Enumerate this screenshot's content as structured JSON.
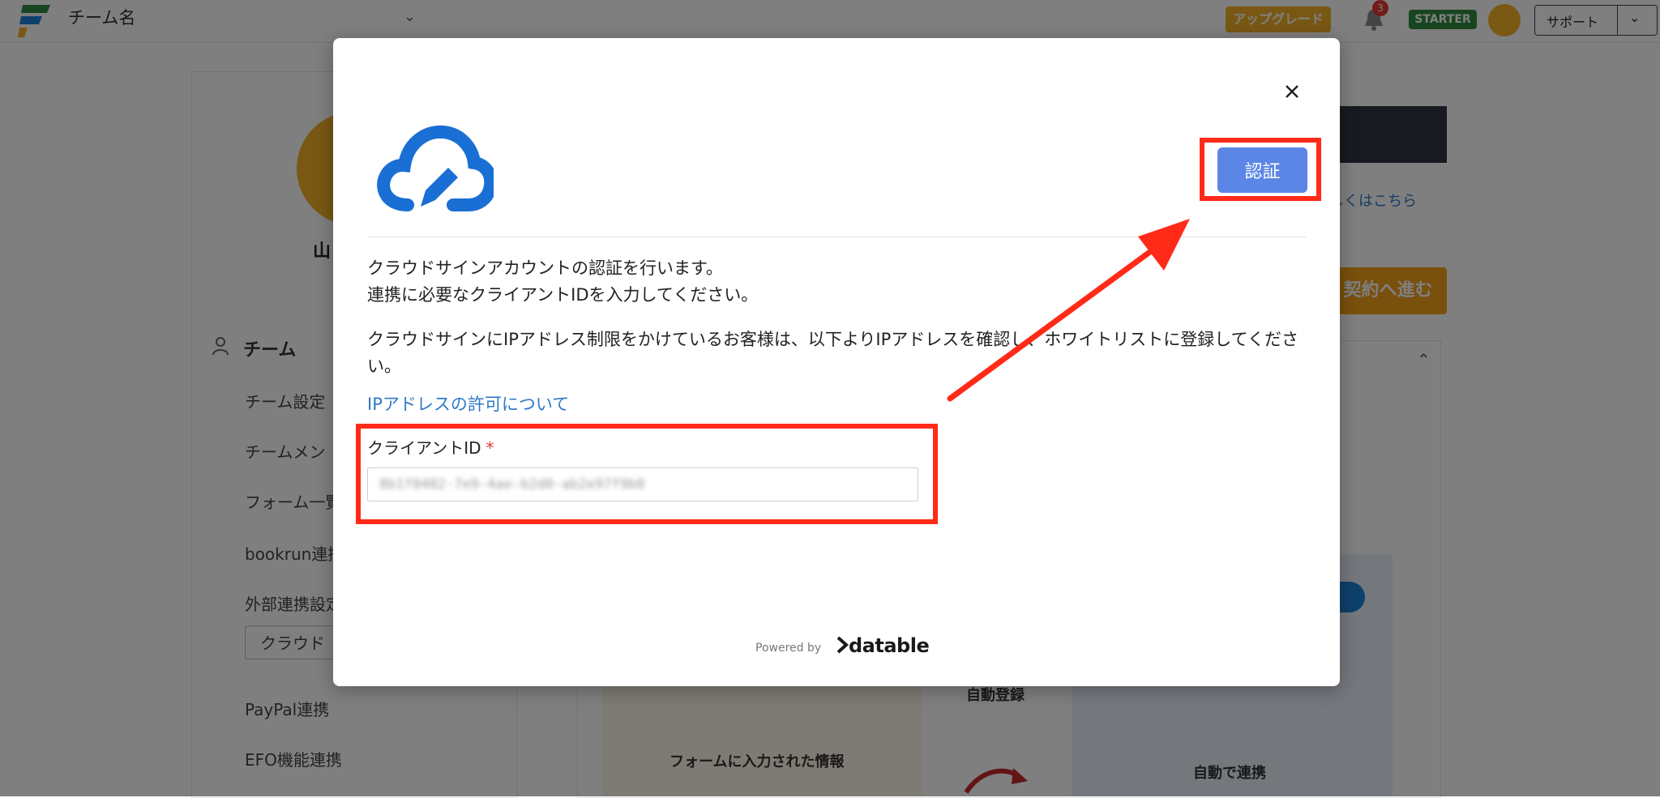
{
  "topbar": {
    "team_name": "チーム名",
    "upgrade_label": "アップグレード",
    "notification_count": "3",
    "plan_badge": "STARTER",
    "support_label": "サポート"
  },
  "sidebar": {
    "user_name": "山",
    "section_title": "チーム",
    "items": [
      {
        "label": "チーム設定"
      },
      {
        "label": "チームメン"
      },
      {
        "label": "フォーム一覧"
      },
      {
        "label": "bookrun連携"
      },
      {
        "label": "外部連携設定"
      },
      {
        "label": "PayPal連携"
      },
      {
        "label": "EFO機能連携"
      }
    ],
    "select_value": "クラウド"
  },
  "main": {
    "detail_link": "しくはこちら",
    "contract_button": "契約へ進む",
    "illus_left_label": "フォームに入力された情報",
    "illus_mid_label": "自動登録",
    "illus_right_label": "自動で連携"
  },
  "modal": {
    "close_label": "×",
    "auth_button": "認証",
    "intro_line1": "クラウドサインアカウントの認証を行います。",
    "intro_line2": "連携に必要なクライアントIDを入力してください。",
    "ip_notice": "クラウドサインにIPアドレス制限をかけているお客様は、以下よりIPアドレスを確認し、ホワイトリストに登録してください。",
    "ip_link": "IPアドレスの許可について",
    "field_label": "クライアントID",
    "field_required": "*",
    "client_id_value": "8b1f0402-7e9-4ae-b2d0-ab2e97f9b0",
    "powered_by": "Powered by",
    "brand": "datable"
  },
  "colors": {
    "accent": "#5b86e5",
    "highlight_red": "#ff2a18",
    "link_blue": "#2f79c9",
    "logo_blue": "#1a6fd4"
  }
}
